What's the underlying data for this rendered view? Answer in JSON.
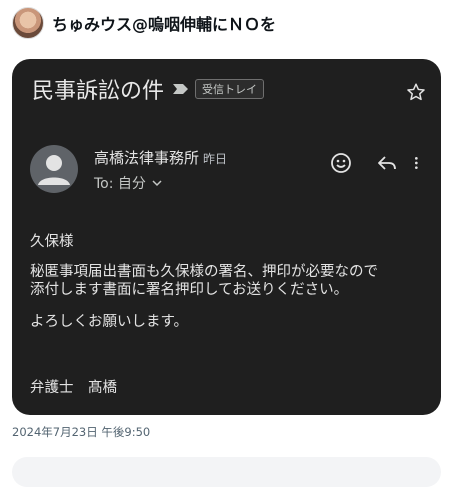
{
  "post": {
    "author": "ちゅみウス@嗚咽伸輔にＮＯを",
    "timestamp": "2024年7月23日 午後9:50"
  },
  "email": {
    "subject": "民事訴訟の件",
    "label": "受信トレイ",
    "sender": "高橋法律事務所",
    "date": "昨日",
    "recipient": "To: 自分",
    "greeting": "久保様",
    "body_line1": "秘匿事項届出書面も久保様の署名、押印が必要なので",
    "body_line2": "添付します書面に署名押印してお送りください。",
    "body_line3": "よろしくお願いします。",
    "signature": "弁護士　髙橋"
  },
  "icons": {
    "importance": "importance-marker-icon",
    "star": "star-icon",
    "sender_avatar": "person-icon",
    "emoji": "emoji-icon",
    "reply": "reply-icon",
    "more": "more-vert-icon",
    "recipient_chevron": "chevron-down-icon"
  },
  "colors": {
    "card_bg": "#1f1f1f",
    "page_bg": "#ffffff",
    "timestamp": "#536471"
  }
}
